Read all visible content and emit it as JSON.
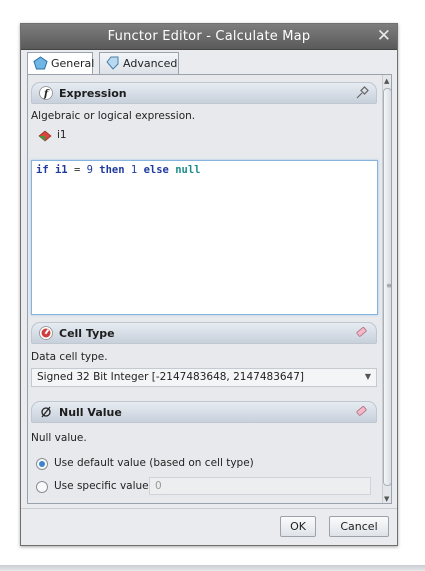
{
  "window": {
    "title": "Functor Editor - Calculate Map",
    "close_glyph": "✕"
  },
  "tabs": [
    {
      "label": "General",
      "icon": "pentagon-icon",
      "active": true
    },
    {
      "label": "Advanced",
      "icon": "diamond-icon",
      "active": false
    }
  ],
  "expression": {
    "header": "Expression",
    "description": "Algebraic or logical expression.",
    "variable": "i1",
    "code": {
      "kw_if": "if",
      "var": "i1",
      "op": "=",
      "num1": "9",
      "kw_then": "then",
      "num2": "1",
      "kw_else": "else",
      "null_kw": "null"
    }
  },
  "cell_type": {
    "header": "Cell Type",
    "description": "Data cell type.",
    "selected": "Signed 32 Bit Integer [-2147483648, 2147483647]"
  },
  "null_value": {
    "header": "Null Value",
    "description": "Null value.",
    "option_default": "Use default value (based on cell type)",
    "option_specific": "Use specific value",
    "specific_value": "0",
    "selected_option": "default"
  },
  "buttons": {
    "ok": "OK",
    "cancel": "Cancel"
  },
  "colors": {
    "titlebar": "#6b6b6b",
    "keyword": "#1f3a9f",
    "null_keyword": "#1f8c8c",
    "radio_selected": "#3c84cf"
  }
}
